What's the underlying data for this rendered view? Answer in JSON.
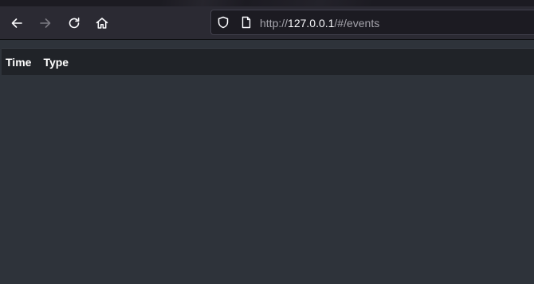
{
  "browser": {
    "nav": {
      "back_icon": "arrow-left-icon",
      "forward_icon": "arrow-right-icon",
      "reload_icon": "reload-icon",
      "home_icon": "home-icon"
    },
    "url": {
      "scheme": "http://",
      "host": "127.0.0.1",
      "path": "/#/events"
    }
  },
  "events_table": {
    "columns": [
      "Time",
      "Type"
    ],
    "rows": []
  },
  "colors": {
    "page_background": "#2e333a",
    "table_header_background": "#202328",
    "toolbar_background": "#2b2a33",
    "url_field_background": "#1c1b22"
  }
}
